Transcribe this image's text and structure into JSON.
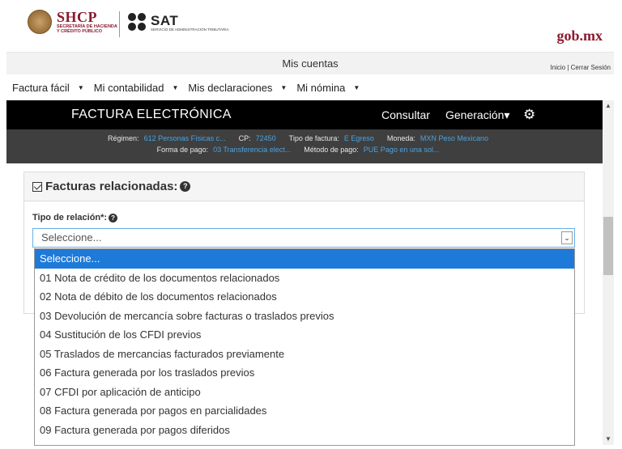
{
  "header": {
    "shcp_title": "SHCP",
    "shcp_sub1": "SECRETARÍA DE HACIENDA",
    "shcp_sub2": "Y CRÉDITO PÚBLICO",
    "sat_title": "SAT",
    "sat_sub": "SERVICIO DE ADMINISTRACIÓN TRIBUTARIA",
    "gob_prefix": "gob",
    "gob_suffix": ".mx"
  },
  "cuentas_bar": {
    "title": "Mis cuentas",
    "inicio": "Inicio",
    "separator": "|",
    "cerrar": "Cerrar Sesión"
  },
  "menu": {
    "items": [
      {
        "label": "Factura fácil"
      },
      {
        "label": "Mi contabilidad"
      },
      {
        "label": "Mis declaraciones"
      },
      {
        "label": "Mi nómina"
      }
    ]
  },
  "fe_bar": {
    "title": "FACTURA ELECTRÓNICA",
    "consultar": "Consultar",
    "generacion": "Generación",
    "generacion_caret": "▾"
  },
  "info": {
    "regimen_label": "Régimen:",
    "regimen_value": "612 Personas Físicas c...",
    "cp_label": "CP:",
    "cp_value": "72450",
    "tipo_label": "Tipo de factura:",
    "tipo_value": "E Egreso",
    "moneda_label": "Moneda:",
    "moneda_value": "MXN Peso Mexicano",
    "forma_label": "Forma de pago:",
    "forma_value": "03 Transferencia elect...",
    "metodo_label": "Método de pago:",
    "metodo_value": "PUE Pago en una sol..."
  },
  "panel": {
    "title": "Facturas relacionadas:",
    "field_label": "Tipo de relación*:",
    "select_value": "Seleccione..."
  },
  "dropdown": {
    "options": [
      "Seleccione...",
      "01 Nota de crédito de los documentos relacionados",
      "02 Nota de débito de los documentos relacionados",
      "03 Devolución de mercancía sobre facturas o traslados previos",
      "04 Sustitución de los CFDI previos",
      "05 Traslados de mercancias facturados previamente",
      "06 Factura generada por los traslados previos",
      "07 CFDI por aplicación de anticipo",
      "08 Factura generada por pagos en parcialidades",
      "09 Factura generada por pagos diferidos"
    ],
    "selected_index": 0
  },
  "colors": {
    "brand": "#8a1a2f",
    "selected": "#1e7ad9",
    "link": "#4aa3df"
  }
}
